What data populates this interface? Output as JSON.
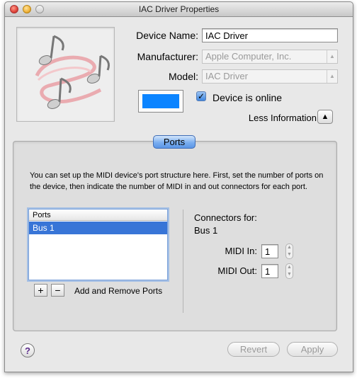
{
  "window": {
    "title": "IAC Driver Properties"
  },
  "device": {
    "name_label": "Device Name:",
    "name_value": "IAC Driver",
    "manufacturer_label": "Manufacturer:",
    "manufacturer_value": "Apple Computer, Inc.",
    "model_label": "Model:",
    "model_value": "IAC Driver",
    "online_label": "Device is online",
    "online_checked": true,
    "color": "#0a84ff"
  },
  "info_toggle": {
    "label": "Less Information",
    "glyph": "▲"
  },
  "ports_tab": {
    "label": "Ports",
    "description": "You can set up the MIDI device's port structure here.  First, set the number of ports on the device, then indicate the number of MIDI in and out connectors for each port.",
    "list": {
      "header": "Ports",
      "items": [
        "Bus 1"
      ],
      "selected": "Bus 1"
    },
    "add_glyph": "+",
    "remove_glyph": "−",
    "add_remove_label": "Add and Remove Ports",
    "connectors_title": "Connectors for:",
    "connectors_bus": "Bus 1",
    "midi_in_label": "MIDI In:",
    "midi_in_value": "1",
    "midi_out_label": "MIDI Out:",
    "midi_out_value": "1"
  },
  "footer": {
    "help_glyph": "?",
    "revert_label": "Revert",
    "apply_label": "Apply"
  },
  "icons": {
    "device_icon": "music-notes-icon",
    "popup_arrow": "chevron-updown-icon",
    "stepper": "stepper-icon"
  }
}
